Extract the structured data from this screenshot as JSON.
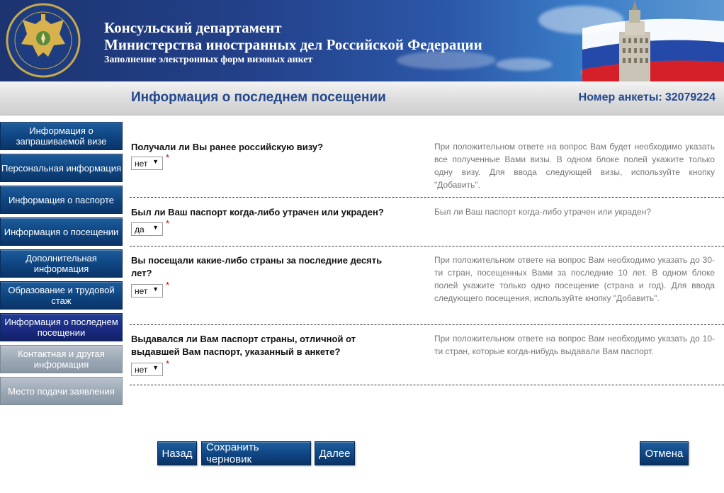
{
  "header": {
    "line1": "Консульский департамент",
    "line2": "Министерства иностранных дел Российской Федерации",
    "line3": "Заполнение электронных форм визовых анкет"
  },
  "titlebar": {
    "title": "Информация о последнем посещении",
    "anketa_label": "Номер анкеты:",
    "anketa_number": "32079224"
  },
  "sidebar": {
    "items": [
      {
        "label": "Информация о запрашиваемой визе",
        "state": "normal"
      },
      {
        "label": "Персональная информация",
        "state": "normal"
      },
      {
        "label": "Информация о паспорте",
        "state": "normal"
      },
      {
        "label": "Информация о посещении",
        "state": "normal"
      },
      {
        "label": "Дополнительная информация",
        "state": "normal"
      },
      {
        "label": "Образование и трудовой стаж",
        "state": "normal"
      },
      {
        "label": "Информация о последнем посещении",
        "state": "active"
      },
      {
        "label": "Контактная и другая информация",
        "state": "disabled"
      },
      {
        "label": "Место подачи заявления",
        "state": "disabled"
      }
    ]
  },
  "questions": [
    {
      "question": "Получали ли Вы ранее российскую визу?",
      "value": "нет",
      "required": "*",
      "hint": "При положительном ответе на вопрос Вам будет необходимо указать все полученные Вами визы. В одном блоке полей укажите только одну визу. Для ввода следующей визы, используйте кнопку \"Добавить\"."
    },
    {
      "question": "Был ли Ваш паспорт когда-либо утрачен или украден?",
      "value": "да",
      "required": "*",
      "hint": "Был ли Ваш паспорт когда-либо утрачен или украден?"
    },
    {
      "question": "Вы посещали какие-либо страны за последние десять лет?",
      "value": "нет",
      "required": "*",
      "hint": "При положительном ответе на вопрос Вам необходимо указать до 30-ти стран, посещенных Вами за последние 10 лет. В одном блоке полей укажите только одно посещение (страна и год). Для ввода следующего посещения, используйте кнопку \"Добавить\"."
    },
    {
      "question": "Выдавался ли Вам паспорт страны, отличной от выдавшей Вам паспорт, указанный в анкете?",
      "value": "нет",
      "required": "*",
      "hint": "При положительном ответе на вопрос Вам необходимо указать до 10-ти стран, которые когда-нибудь выдавали Вам паспорт."
    }
  ],
  "buttons": {
    "back": "Назад",
    "save_draft": "Сохранить черновик",
    "next": "Далее",
    "cancel": "Отмена"
  },
  "icons": {
    "emblem": "mfa-emblem-icon",
    "flag": "russian-flag-building-icon",
    "select_arrow": "dropdown-arrow-icon"
  },
  "colors": {
    "accent": "#25488c",
    "nav_button": "#0e4480",
    "nav_active": "#1a2a80",
    "nav_disabled": "#98a5b2",
    "required": "#d40000"
  }
}
